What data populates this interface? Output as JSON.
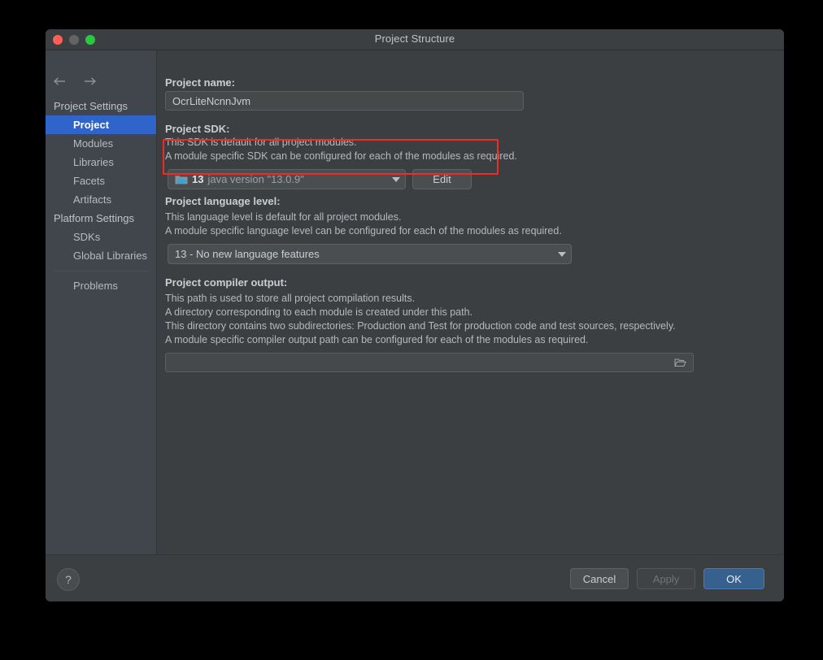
{
  "window": {
    "title": "Project Structure",
    "traffic_lights": [
      "close-red",
      "minimize-gray",
      "maximize-green"
    ]
  },
  "sidebar": {
    "nav": {
      "back": "back-arrow",
      "forward": "forward-arrow"
    },
    "items": [
      {
        "label": "Project Settings",
        "type": "group",
        "selected": false
      },
      {
        "label": "Project",
        "type": "child",
        "selected": true
      },
      {
        "label": "Modules",
        "type": "child",
        "selected": false
      },
      {
        "label": "Libraries",
        "type": "child",
        "selected": false
      },
      {
        "label": "Facets",
        "type": "child",
        "selected": false
      },
      {
        "label": "Artifacts",
        "type": "child",
        "selected": false
      },
      {
        "label": "Platform Settings",
        "type": "group",
        "selected": false
      },
      {
        "label": "SDKs",
        "type": "child",
        "selected": false
      },
      {
        "label": "Global Libraries",
        "type": "child",
        "selected": false
      },
      {
        "label": "Problems",
        "type": "child",
        "selected": false
      }
    ]
  },
  "main": {
    "project_name": {
      "label": "Project name:",
      "value": "OcrLiteNcnnJvm"
    },
    "project_sdk": {
      "label": "Project SDK:",
      "desc1": "This SDK is default for all project modules.",
      "desc2": "A module specific SDK can be configured for each of the modules as required.",
      "selected_number": "13",
      "selected_version": "java version \"13.0.9\"",
      "edit_button": "Edit"
    },
    "language_level": {
      "label": "Project language level:",
      "desc1": "This language level is default for all project modules.",
      "desc2": "A module specific language level can be configured for each of the modules as required.",
      "value": "13 - No new language features"
    },
    "compiler_output": {
      "label": "Project compiler output:",
      "desc1": "This path is used to store all project compilation results.",
      "desc2": "A directory corresponding to each module is created under this path.",
      "desc3": "This directory contains two subdirectories: Production and Test for production code and test sources, respectively.",
      "desc4": "A module specific compiler output path can be configured for each of the modules as required.",
      "value": "",
      "browse_icon": "folder-icon"
    }
  },
  "footer": {
    "help_label": "?",
    "cancel_label": "Cancel",
    "apply_label": "Apply",
    "ok_label": "OK"
  },
  "annotation": {
    "highlight_color": "#ee2b24",
    "target": "project-sdk-row"
  }
}
